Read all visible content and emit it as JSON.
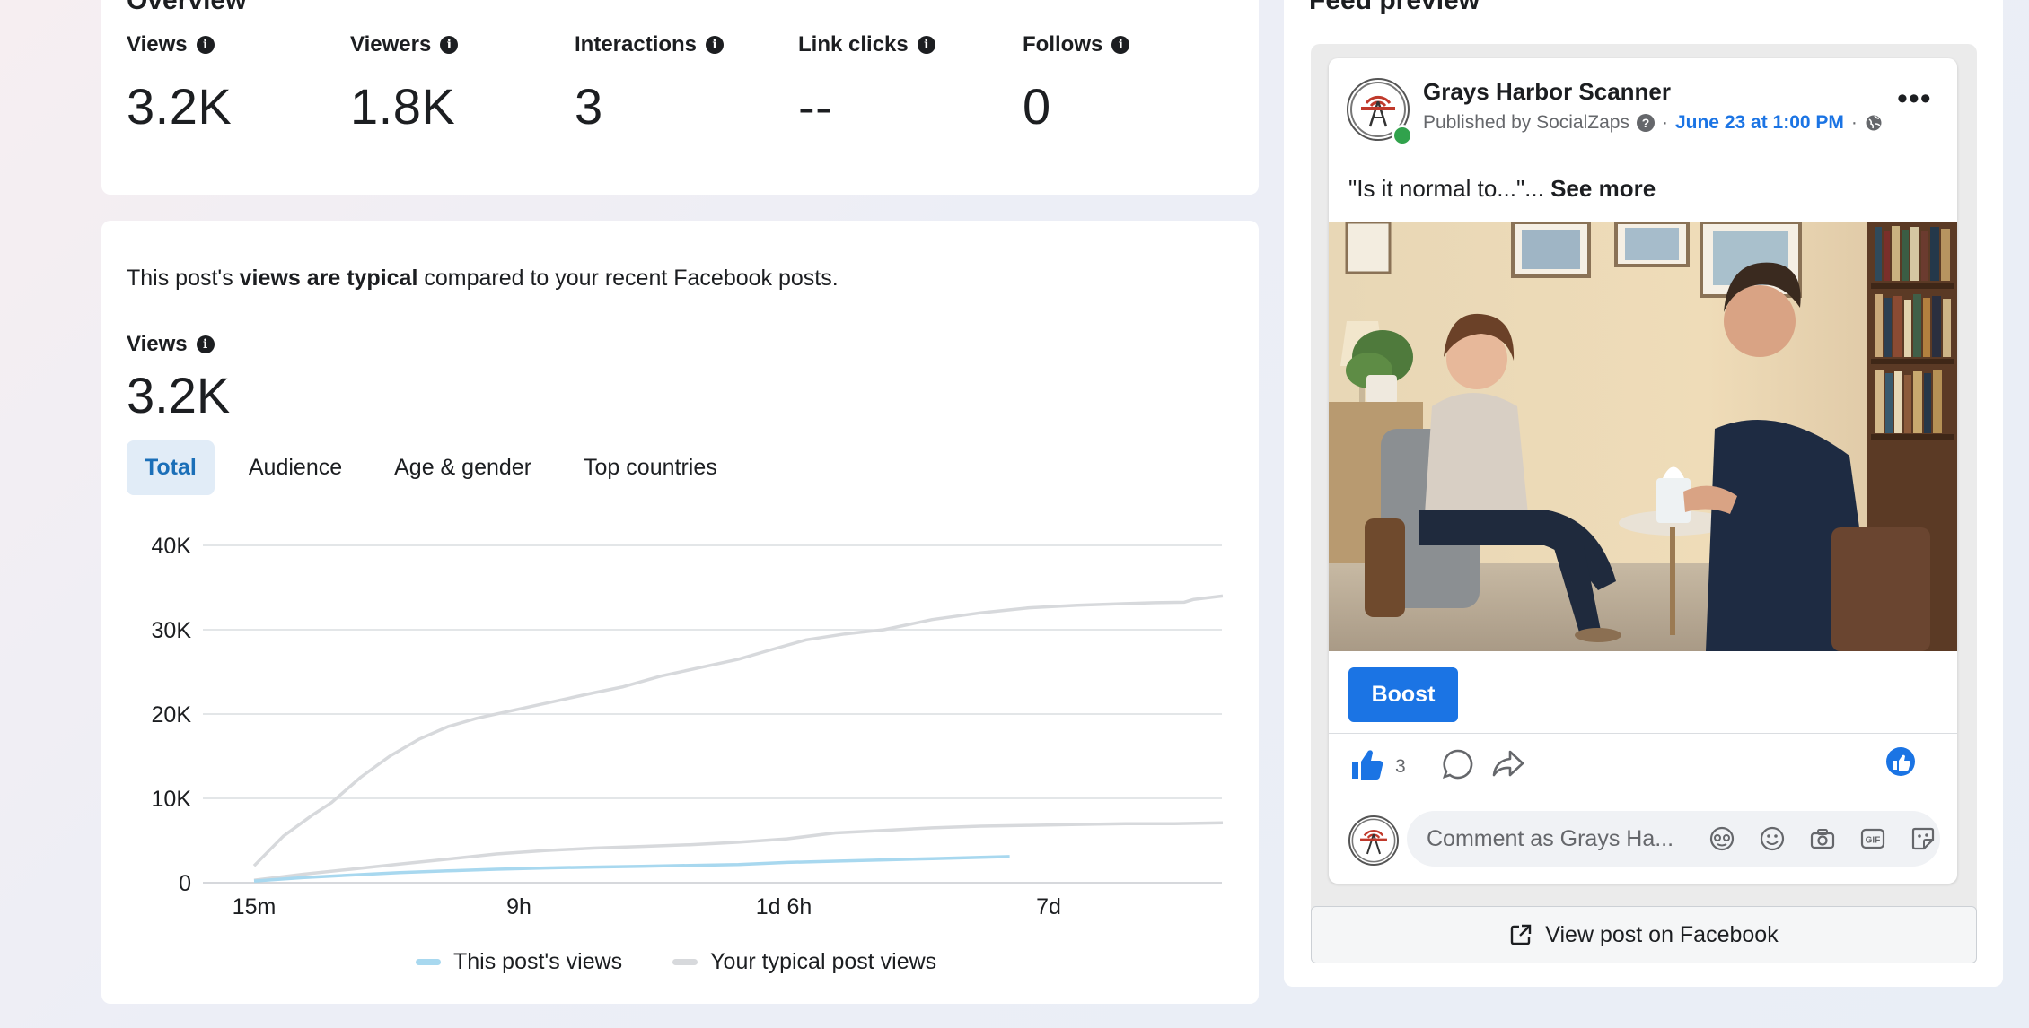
{
  "overview": {
    "title": "Overview",
    "metrics": [
      {
        "label": "Views",
        "value": "3.2K"
      },
      {
        "label": "Viewers",
        "value": "1.8K"
      },
      {
        "label": "Interactions",
        "value": "3"
      },
      {
        "label": "Link clicks",
        "value": "--"
      },
      {
        "label": "Follows",
        "value": "0"
      }
    ]
  },
  "views_panel": {
    "summary_prefix": "This post's ",
    "summary_bold": "views are typical",
    "summary_suffix": " compared to your recent Facebook posts.",
    "views_label": "Views",
    "views_value": "3.2K",
    "tabs": [
      {
        "label": "Total",
        "active": true
      },
      {
        "label": "Audience",
        "active": false
      },
      {
        "label": "Age & gender",
        "active": false
      },
      {
        "label": "Top countries",
        "active": false
      }
    ]
  },
  "chart_data": {
    "type": "line",
    "title": "",
    "xlabel": "",
    "ylabel": "",
    "ylim": [
      0,
      40000
    ],
    "y_ticks": [
      {
        "value": 0,
        "label": "0"
      },
      {
        "value": 10000,
        "label": "10K"
      },
      {
        "value": 20000,
        "label": "20K"
      },
      {
        "value": 30000,
        "label": "30K"
      },
      {
        "value": 40000,
        "label": "40K"
      }
    ],
    "x_ticks": [
      "15m",
      "9h",
      "1d 6h",
      "7d"
    ],
    "grid": true,
    "legend_position": "bottom",
    "series": [
      {
        "name": "Your typical post views",
        "color": "#d7d9dc",
        "x": [
          0.0,
          0.03,
          0.06,
          0.08,
          0.11,
          0.14,
          0.17,
          0.2,
          0.23,
          0.27,
          0.31,
          0.35,
          0.38,
          0.42,
          0.46,
          0.5,
          0.53,
          0.57,
          0.61,
          0.65,
          0.7,
          0.75,
          0.8,
          0.85,
          0.9,
          0.93,
          0.96,
          0.97,
          1.0
        ],
        "y": [
          2000,
          5500,
          8000,
          9500,
          12500,
          15000,
          17000,
          18500,
          19500,
          20500,
          21500,
          22500,
          23200,
          24500,
          25500,
          26500,
          27500,
          28800,
          29500,
          30000,
          31200,
          32000,
          32600,
          32900,
          33100,
          33200,
          33250,
          33600,
          34000
        ]
      },
      {
        "name": "Your typical post views",
        "color": "#d7d9dc",
        "x": [
          0.0,
          0.05,
          0.1,
          0.15,
          0.2,
          0.25,
          0.3,
          0.35,
          0.4,
          0.45,
          0.5,
          0.55,
          0.6,
          0.65,
          0.7,
          0.75,
          0.8,
          0.85,
          0.9,
          0.95,
          1.0
        ],
        "y": [
          300,
          1000,
          1600,
          2200,
          2800,
          3400,
          3800,
          4100,
          4300,
          4500,
          4800,
          5200,
          5900,
          6200,
          6500,
          6700,
          6800,
          6900,
          7000,
          7000,
          7100
        ]
      },
      {
        "name": "This post's views",
        "color": "#a8d8ef",
        "x": [
          0.0,
          0.05,
          0.1,
          0.15,
          0.2,
          0.25,
          0.3,
          0.35,
          0.4,
          0.45,
          0.5,
          0.55,
          0.6,
          0.65,
          0.7,
          0.78
        ],
        "y": [
          200,
          600,
          900,
          1200,
          1400,
          1600,
          1750,
          1850,
          1950,
          2050,
          2150,
          2400,
          2550,
          2700,
          2850,
          3100
        ]
      }
    ],
    "legend": [
      {
        "label": "This post's views",
        "color": "#a8d8ef"
      },
      {
        "label": "Your typical post views",
        "color": "#d7d9dc"
      }
    ]
  },
  "feed": {
    "title": "Feed preview",
    "page_name": "Grays Harbor Scanner",
    "published_by": "Published by SocialZaps",
    "date": "June 23 at 1:00 PM",
    "separator": "·",
    "post_text": "\"Is it normal to...\"...",
    "see_more": "See more",
    "boost_label": "Boost",
    "like_count": "3",
    "comment_placeholder": "Comment as Grays Ha...",
    "view_post_label": "View post on Facebook",
    "colors": {
      "brand": "#1b74e4",
      "online": "#31a24c"
    }
  }
}
